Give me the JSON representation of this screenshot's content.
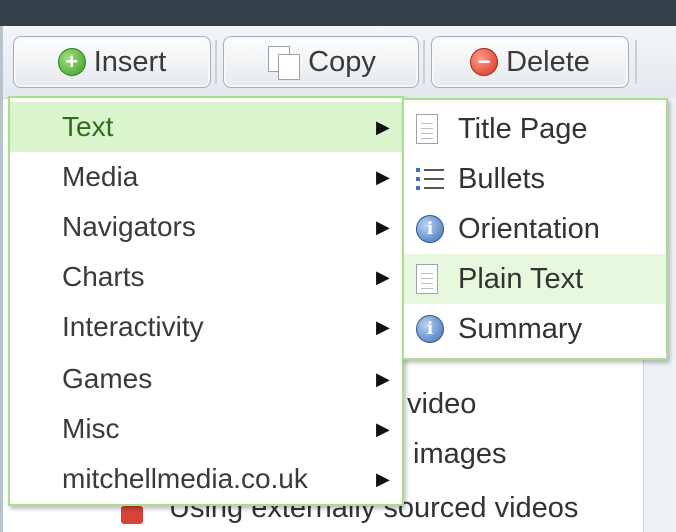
{
  "toolbar": {
    "insert_label": "Insert",
    "copy_label": "Copy",
    "delete_label": "Delete"
  },
  "background": {
    "line1": "video",
    "line2": "images",
    "line3": "Using externally sourced videos"
  },
  "menu": {
    "items": [
      {
        "label": "Text"
      },
      {
        "label": "Media"
      },
      {
        "label": "Navigators"
      },
      {
        "label": "Charts"
      },
      {
        "label": "Interactivity"
      },
      {
        "label": "Games"
      },
      {
        "label": "Misc"
      },
      {
        "label": "mitchellmedia.co.uk"
      }
    ],
    "active": "Text"
  },
  "submenu": {
    "items": [
      {
        "label": "Title Page",
        "icon": "document-icon"
      },
      {
        "label": "Bullets",
        "icon": "bullets-icon"
      },
      {
        "label": "Orientation",
        "icon": "info-icon"
      },
      {
        "label": "Plain Text",
        "icon": "document-icon"
      },
      {
        "label": "Summary",
        "icon": "info-icon"
      }
    ],
    "hovered": "Plain Text"
  },
  "colors": {
    "menu_border": "#a8df8c",
    "active_item_bg": "#dbf5ce",
    "window_frame": "#37414a"
  }
}
